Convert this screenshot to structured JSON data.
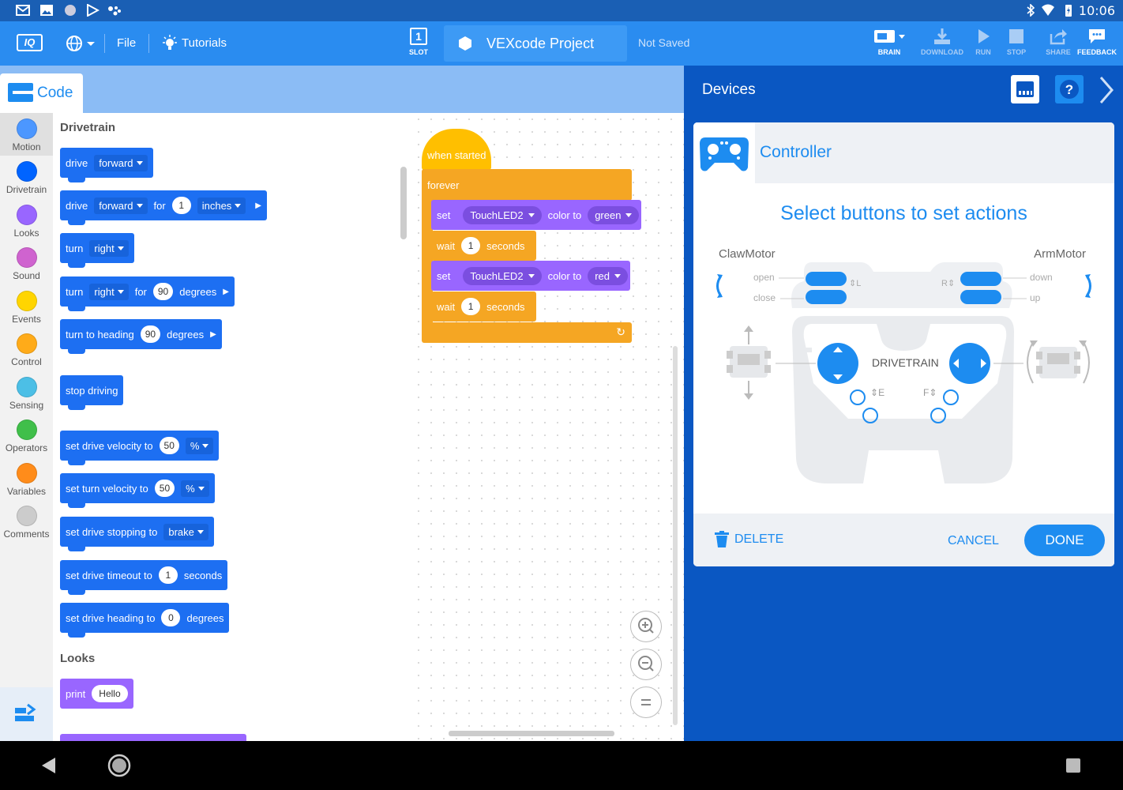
{
  "status_bar": {
    "time": "10:06"
  },
  "toolbar": {
    "file_label": "File",
    "tutorials_label": "Tutorials",
    "slot_number": "1",
    "slot_label": "SLOT",
    "project_name": "VEXcode Project",
    "save_status": "Not Saved",
    "brain_label": "BRAIN",
    "download_label": "DOWNLOAD",
    "run_label": "RUN",
    "stop_label": "STOP",
    "share_label": "SHARE",
    "feedback_label": "FEEDBACK"
  },
  "code_tab": {
    "label": "Code"
  },
  "categories": [
    {
      "label": "Motion",
      "color": "#4c97ff"
    },
    {
      "label": "Drivetrain",
      "color": "#0064ff"
    },
    {
      "label": "Looks",
      "color": "#9966ff"
    },
    {
      "label": "Sound",
      "color": "#cf63cf"
    },
    {
      "label": "Events",
      "color": "#ffd500"
    },
    {
      "label": "Control",
      "color": "#ffab19"
    },
    {
      "label": "Sensing",
      "color": "#4cbfe6"
    },
    {
      "label": "Operators",
      "color": "#40bf4a"
    },
    {
      "label": "Variables",
      "color": "#ff8c1a"
    },
    {
      "label": "Comments",
      "color": "#cccccc"
    }
  ],
  "palette": {
    "drivetrain_title": "Drivetrain",
    "looks_title": "Looks",
    "b_drive": {
      "w1": "drive",
      "d1": "forward"
    },
    "b_drive_for": {
      "w1": "drive",
      "d1": "forward",
      "w2": "for",
      "v1": "1",
      "d2": "inches"
    },
    "b_turn": {
      "w1": "turn",
      "d1": "right"
    },
    "b_turn_for": {
      "w1": "turn",
      "d1": "right",
      "w2": "for",
      "v1": "90",
      "d2": "degrees"
    },
    "b_heading": {
      "w1": "turn to heading",
      "v1": "90",
      "d2": "degrees"
    },
    "b_stop": {
      "w1": "stop driving"
    },
    "b_drive_vel": {
      "w1": "set drive velocity to",
      "v1": "50",
      "d2": "%"
    },
    "b_turn_vel": {
      "w1": "set turn velocity to",
      "v1": "50",
      "d2": "%"
    },
    "b_stopping": {
      "w1": "set drive stopping to",
      "d2": "brake"
    },
    "b_timeout": {
      "w1": "set drive timeout to",
      "v1": "1",
      "w2": "seconds"
    },
    "b_drive_heading": {
      "w1": "set drive heading to",
      "v1": "0",
      "w2": "degrees"
    },
    "b_print": {
      "w1": "print",
      "v1": "Hello"
    }
  },
  "script": {
    "hat": "when started",
    "forever": "forever",
    "set1": {
      "w1": "set",
      "device": "TouchLED2",
      "w2": "color to",
      "color": "green"
    },
    "wait1": {
      "w1": "wait",
      "v": "1",
      "w2": "seconds"
    },
    "set2": {
      "w1": "set",
      "device": "TouchLED2",
      "w2": "color to",
      "color": "red"
    },
    "wait2": {
      "w1": "wait",
      "v": "1",
      "w2": "seconds"
    }
  },
  "devices": {
    "title": "Devices",
    "controller_title": "Controller",
    "instruction": "Select buttons to set actions",
    "claw_motor": "ClawMotor",
    "arm_motor": "ArmMotor",
    "open": "open",
    "close": "close",
    "down": "down",
    "up": "up",
    "drivetrain": "DRIVETRAIN",
    "btn_e": "E",
    "btn_f": "F",
    "delete_label": "DELETE",
    "cancel_label": "CANCEL",
    "done_label": "DONE"
  }
}
